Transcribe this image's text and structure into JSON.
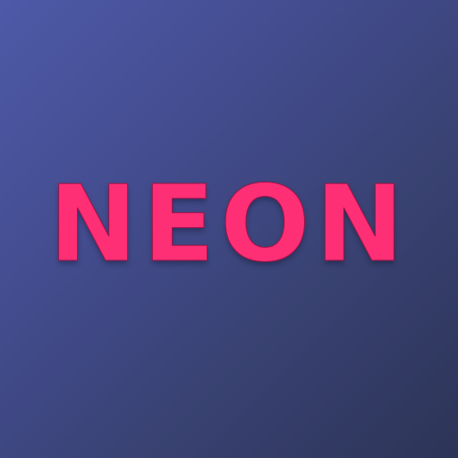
{
  "logo": {
    "text": "NEON",
    "colors": {
      "letter_fill": "#ff2f75",
      "letter_inline": "#9b1447",
      "background_top_left": "#4e5aa8",
      "background_bottom_right": "#2c3457"
    }
  }
}
